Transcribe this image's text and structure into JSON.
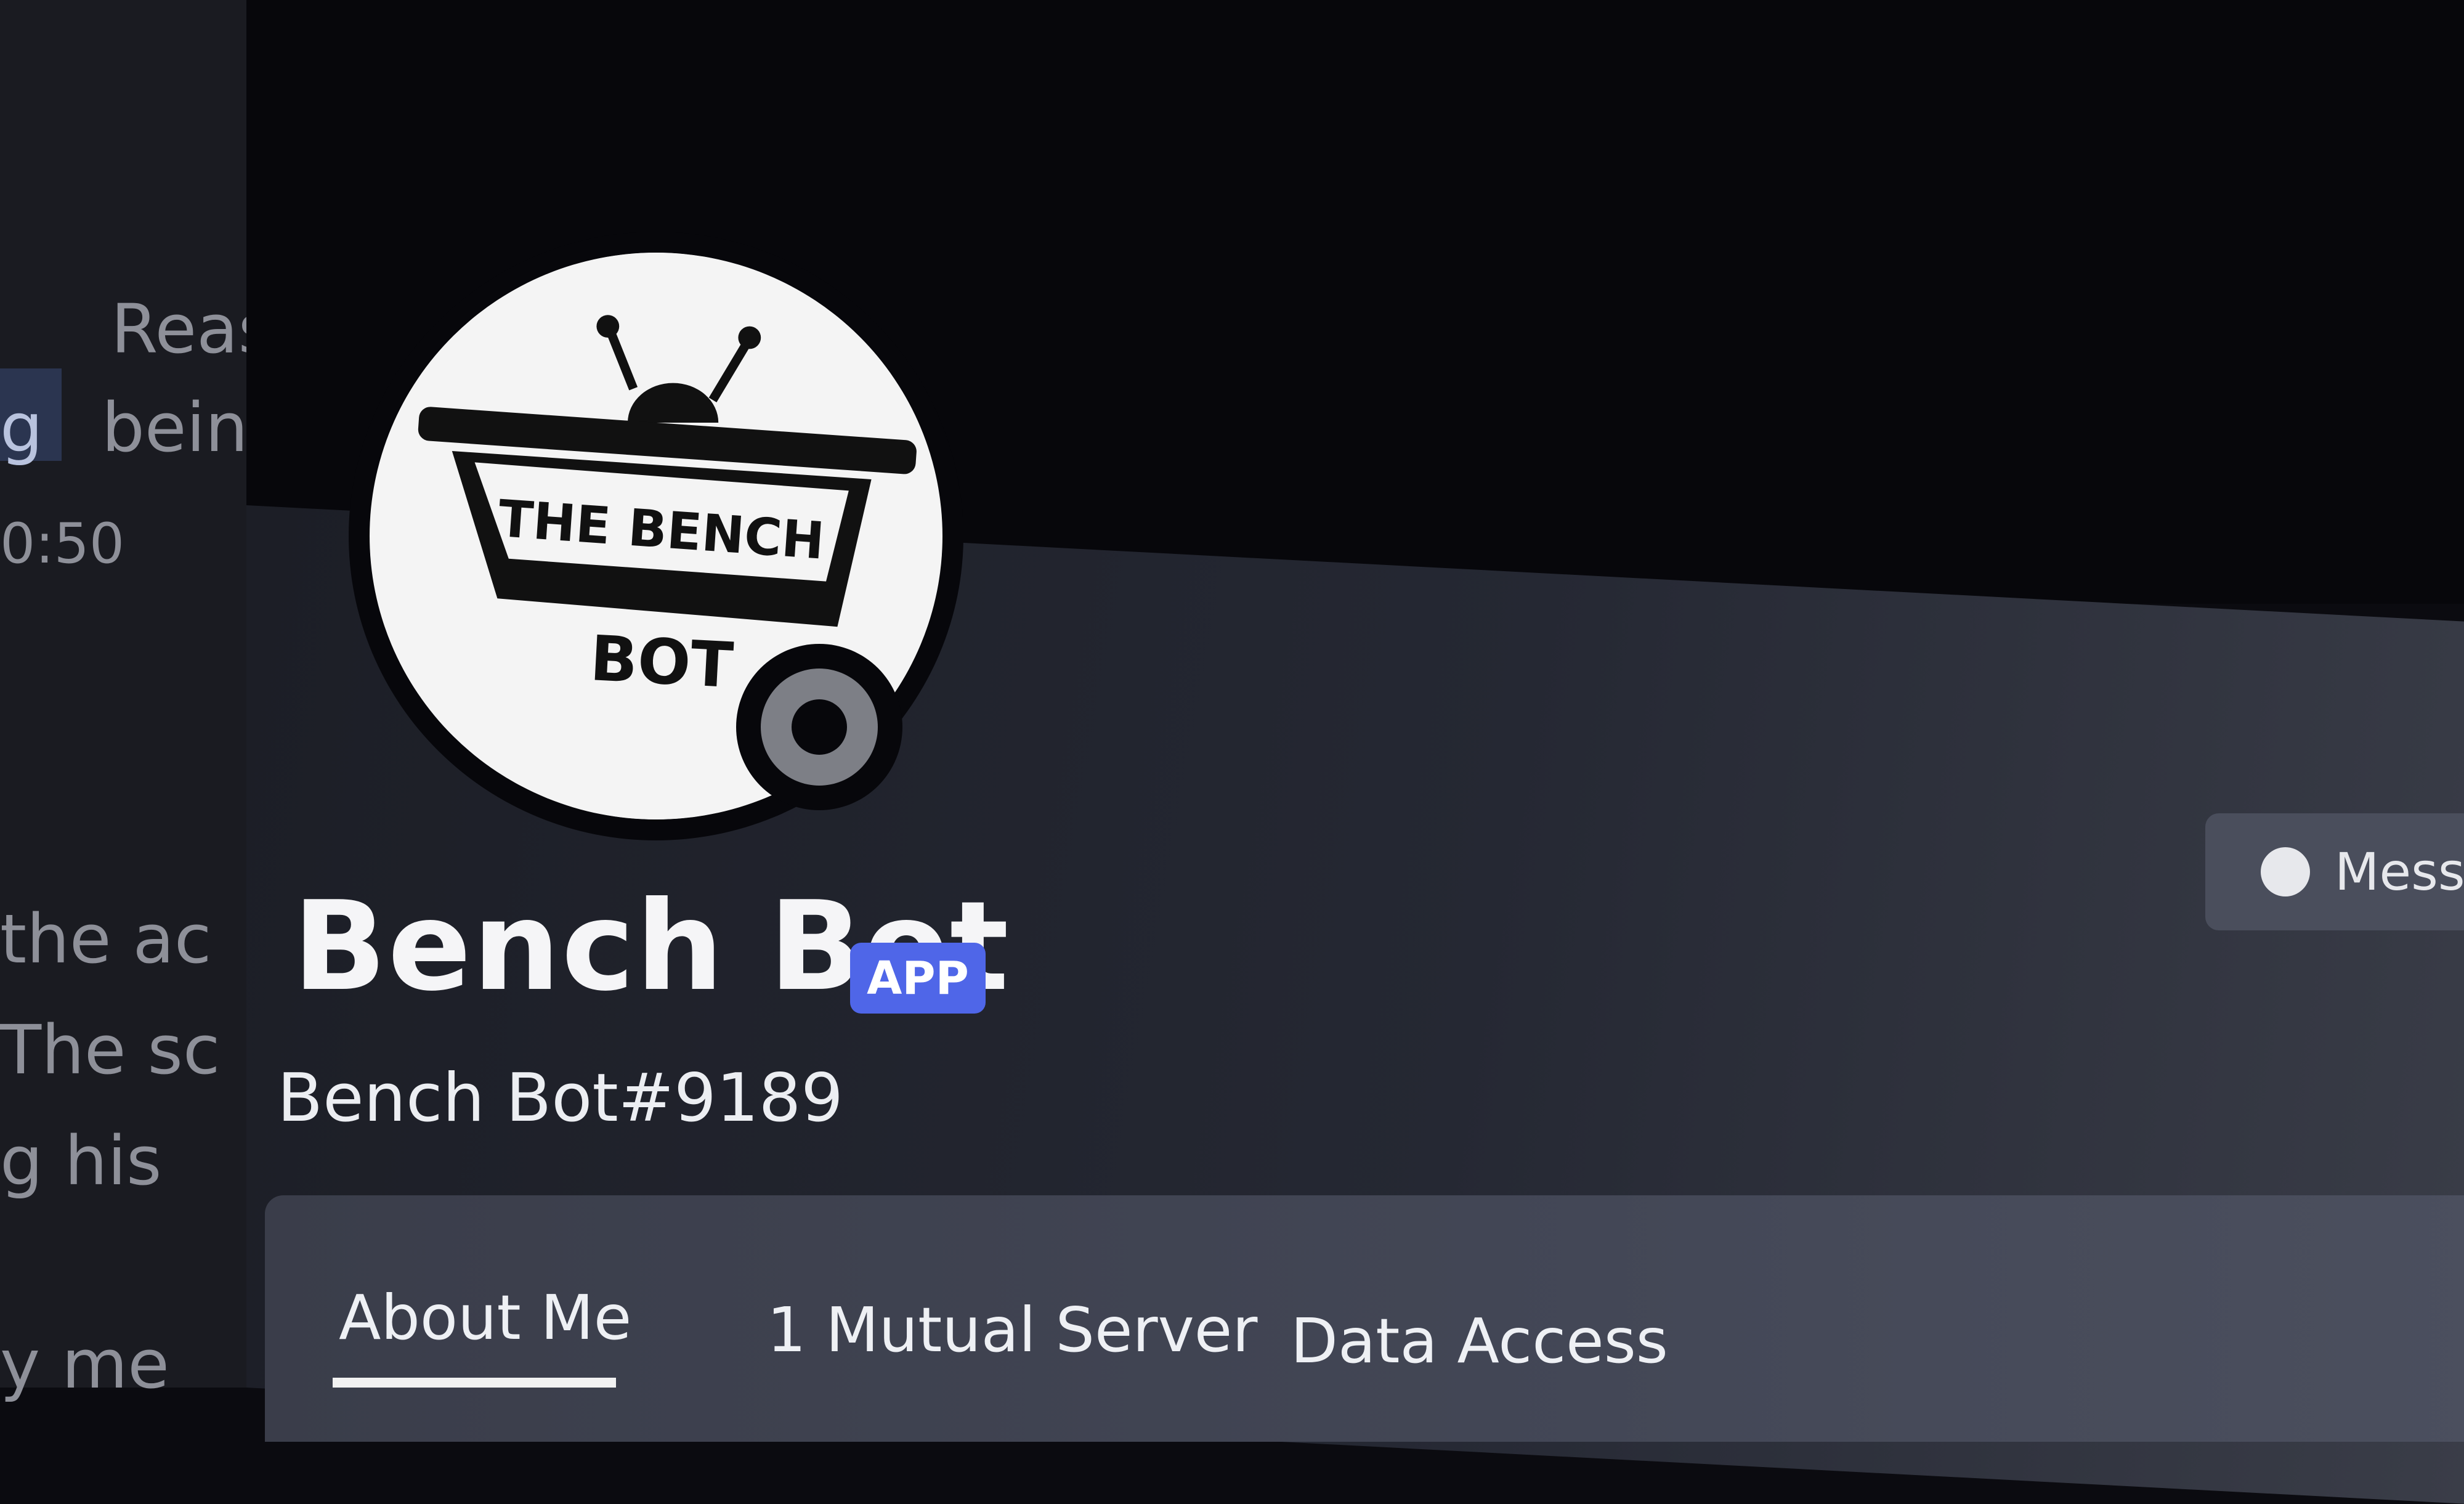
{
  "background_chat": {
    "lines": [
      "Reas",
      "g",
      "being",
      "0:50",
      "the ac",
      "The sc",
      "g his",
      "y me"
    ]
  },
  "profile": {
    "display_name": "Bench Bot",
    "badge": "APP",
    "username": "Bench Bot#9189",
    "avatar_logo_text": "THE BENCH BOT"
  },
  "actions": {
    "message_label": "Messa"
  },
  "tabs": [
    {
      "label": "About Me",
      "active": true
    },
    {
      "label": "1 Mutual Server",
      "active": false
    },
    {
      "label": "Data Access",
      "active": false
    }
  ],
  "colors": {
    "badge_blue": "#4f66e8",
    "background": "#0b0b10",
    "card": "#252833"
  }
}
